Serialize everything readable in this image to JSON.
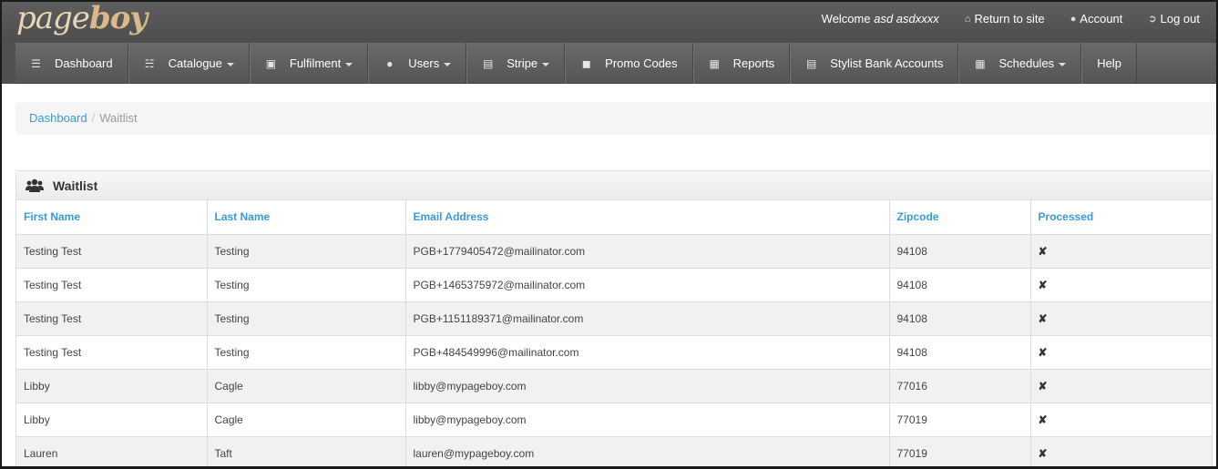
{
  "brand": {
    "logo_left": "page",
    "logo_right": "boy"
  },
  "topnav": {
    "welcome_prefix": "Welcome",
    "user_name": "asd asdxxxx",
    "return_label": "Return to site",
    "account_label": "Account",
    "logout_label": "Log out"
  },
  "mainnav": {
    "items": [
      {
        "label": "Dashboard",
        "icon": "list-icon",
        "dropdown": false
      },
      {
        "label": "Catalogue",
        "icon": "sitemap-icon",
        "dropdown": true
      },
      {
        "label": "Fulfilment",
        "icon": "cart-icon",
        "dropdown": true
      },
      {
        "label": "Users",
        "icon": "users-icon",
        "dropdown": true
      },
      {
        "label": "Stripe",
        "icon": "credit-card-icon",
        "dropdown": true
      },
      {
        "label": "Promo Codes",
        "icon": "bullhorn-icon",
        "dropdown": false
      },
      {
        "label": "Reports",
        "icon": "bar-chart-icon",
        "dropdown": false
      },
      {
        "label": "Stylist Bank Accounts",
        "icon": "credit-card-icon",
        "dropdown": false
      },
      {
        "label": "Schedules",
        "icon": "calendar-icon",
        "dropdown": true
      },
      {
        "label": "Help",
        "icon": "",
        "dropdown": false
      }
    ]
  },
  "breadcrumb": {
    "home": "Dashboard",
    "separator": "/",
    "current": "Waitlist"
  },
  "panel": {
    "title": "Waitlist",
    "icon": "users-icon"
  },
  "table": {
    "headers": [
      "First Name",
      "Last Name",
      "Email Address",
      "Zipcode",
      "Processed"
    ],
    "rows": [
      [
        "Testing Test",
        "Testing",
        "PGB+1779405472@mailinator.com",
        "94108",
        "✘"
      ],
      [
        "Testing Test",
        "Testing",
        "PGB+1465375972@mailinator.com",
        "94108",
        "✘"
      ],
      [
        "Testing Test",
        "Testing",
        "PGB+1151189371@mailinator.com",
        "94108",
        "✘"
      ],
      [
        "Testing Test",
        "Testing",
        "PGB+484549996@mailinator.com",
        "94108",
        "✘"
      ],
      [
        "Libby",
        "Cagle",
        "libby@mypageboy.com",
        "77016",
        "✘"
      ],
      [
        "Libby",
        "Cagle",
        "libby@mypageboy.com",
        "77019",
        "✘"
      ],
      [
        "Lauren",
        "Taft",
        "lauren@mypageboy.com",
        "77019",
        "✘"
      ]
    ]
  },
  "colors": {
    "link": "#3a9ad9",
    "nav_bg": "#555555",
    "logo": "#d9b98a"
  }
}
